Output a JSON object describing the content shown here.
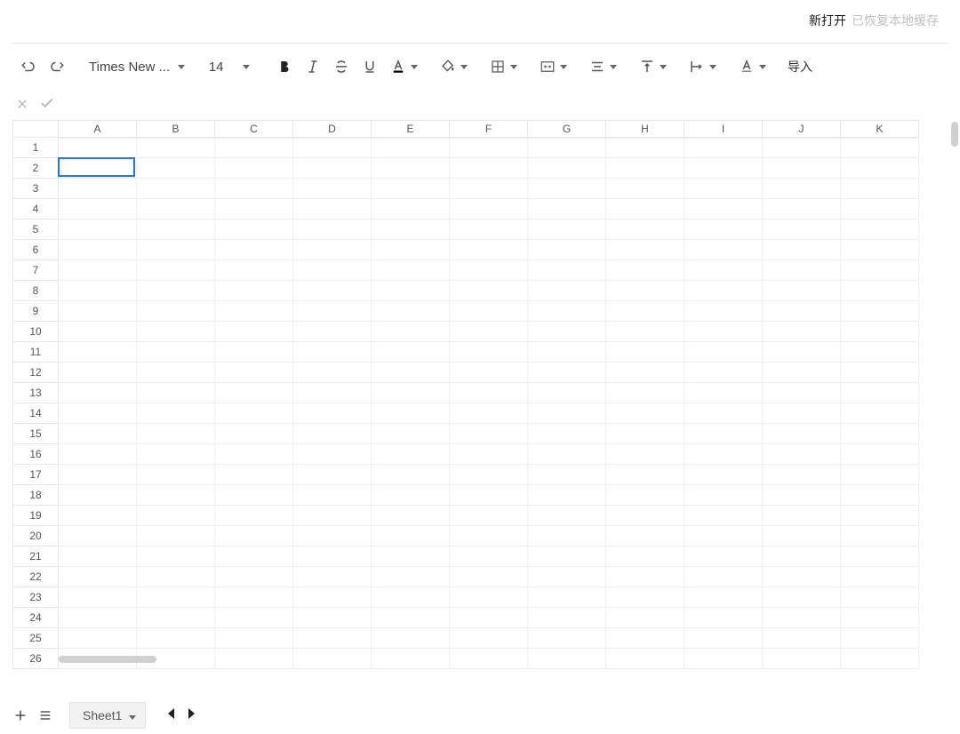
{
  "header": {
    "open_label": "新打开",
    "restore_label": "已恢复本地缓存"
  },
  "toolbar": {
    "font_name": "Times New ...",
    "font_size": "14",
    "import_label": "导入"
  },
  "grid": {
    "columns": [
      "A",
      "B",
      "C",
      "D",
      "E",
      "F",
      "G",
      "H",
      "I",
      "J",
      "K"
    ],
    "row_count": 26,
    "selected": {
      "row": 2,
      "col": "A"
    }
  },
  "sheetbar": {
    "active_sheet": "Sheet1"
  }
}
